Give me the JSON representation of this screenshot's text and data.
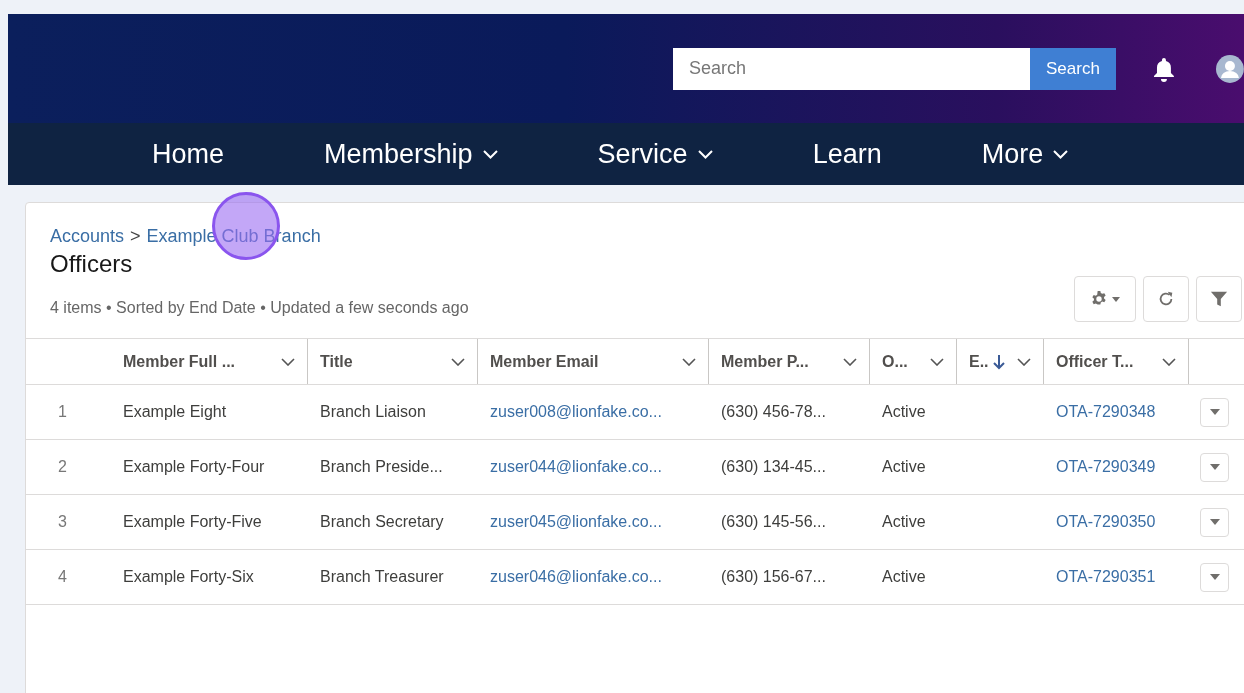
{
  "header": {
    "search": {
      "placeholder": "Search"
    },
    "search_button": "Search"
  },
  "nav": [
    {
      "label": "Home",
      "has_menu": false
    },
    {
      "label": "Membership",
      "has_menu": true
    },
    {
      "label": "Service",
      "has_menu": true
    },
    {
      "label": "Learn",
      "has_menu": false
    },
    {
      "label": "More",
      "has_menu": true
    }
  ],
  "breadcrumb": [
    {
      "label": "Accounts"
    },
    {
      "label": "Example Club Branch"
    }
  ],
  "breadcrumb_separator": ">",
  "title": "Officers",
  "summary": "4 items • Sorted by End Date • Updated a few seconds ago",
  "table": {
    "columns": [
      {
        "label": "Member Full ...",
        "kind": "text",
        "sorted": false
      },
      {
        "label": "Title",
        "kind": "text",
        "sorted": false
      },
      {
        "label": "Member Email",
        "kind": "link",
        "sorted": false
      },
      {
        "label": "Member P...",
        "kind": "text",
        "sorted": false
      },
      {
        "label": "O...",
        "kind": "text",
        "sorted": false
      },
      {
        "label": "E..",
        "sorted": true
      },
      {
        "label": "Officer T...",
        "kind": "link",
        "sorted": false
      }
    ],
    "rows": [
      {
        "number": "1",
        "cells": [
          "Example Eight",
          "Branch Liaison",
          "zuser008@lionfake.co...",
          "(630) 456-78...",
          "Active",
          "",
          "OTA-7290348"
        ]
      },
      {
        "number": "2",
        "cells": [
          "Example Forty-Four",
          "Branch Preside...",
          "zuser044@lionfake.co...",
          "(630) 134-45...",
          "Active",
          "",
          "OTA-7290349"
        ]
      },
      {
        "number": "3",
        "cells": [
          "Example Forty-Five",
          "Branch Secretary",
          "zuser045@lionfake.co...",
          "(630) 145-56...",
          "Active",
          "",
          "OTA-7290350"
        ]
      },
      {
        "number": "4",
        "cells": [
          "Example Forty-Six",
          "Branch Treasurer",
          "zuser046@lionfake.co...",
          "(630) 156-67...",
          "Active",
          "",
          "OTA-7290351"
        ]
      }
    ]
  },
  "click_marker": true
}
